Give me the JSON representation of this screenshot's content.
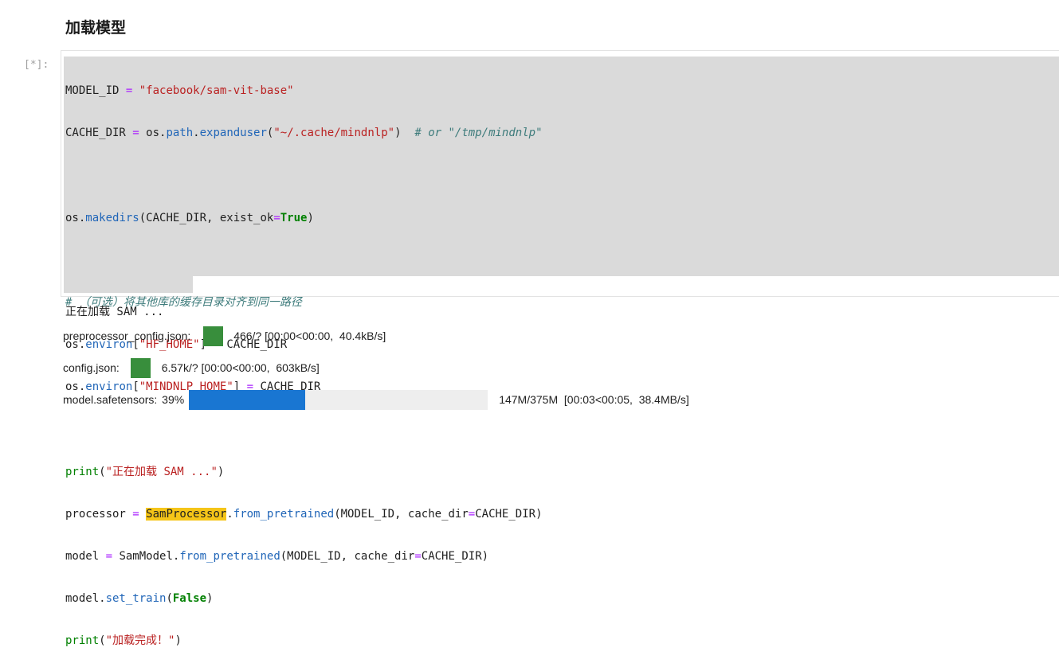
{
  "section_heading": "加载模型",
  "cell": {
    "prompt": "[*]:"
  },
  "code": {
    "l1_var": "MODEL_ID ",
    "l1_op": "=",
    "l1_str": "\"facebook/sam-vit-base\"",
    "l2_var": "CACHE_DIR ",
    "l2_op": "=",
    "l2_a": " os.",
    "l2_attr": "path",
    "l2_b": ".",
    "l2_attr2": "expanduser",
    "l2_c": "(",
    "l2_str": "\"~/.cache/mindnlp\"",
    "l2_d": ")  ",
    "l2_cm": "# or \"/tmp/mindnlp\"",
    "l4_a": "os.",
    "l4_attr": "makedirs",
    "l4_b": "(CACHE_DIR, exist_ok",
    "l4_op": "=",
    "l4_kw": "True",
    "l4_c": ")",
    "l6_cm": "# （可选）将其他库的缓存目录对齐到同一路径",
    "l7_a": "os.",
    "l7_attr": "environ",
    "l7_b": "[",
    "l7_str": "\"HF_HOME\"",
    "l7_c": "] ",
    "l7_op": "=",
    "l7_d": " CACHE_DIR",
    "l8_a": "os.",
    "l8_attr": "environ",
    "l8_b": "[",
    "l8_str": "\"MINDNLP_HOME\"",
    "l8_c": "] ",
    "l8_op": "=",
    "l8_d": " CACHE_DIR",
    "l10_bi": "print",
    "l10_a": "(",
    "l10_str": "\"正在加载 SAM ...\"",
    "l10_b": ")",
    "l11_a": "processor ",
    "l11_op": "=",
    "l11_sp": " ",
    "l11_hl": "SamProcessor",
    "l11_b": ".",
    "l11_attr": "from_pretrained",
    "l11_c": "(MODEL_ID, cache_dir",
    "l11_op2": "=",
    "l11_d": "CACHE_DIR)",
    "l12_a": "model ",
    "l12_op": "=",
    "l12_b": " SamModel.",
    "l12_attr": "from_pretrained",
    "l12_c": "(MODEL_ID, cache_dir",
    "l12_op2": "=",
    "l12_d": "CACHE_DIR)",
    "l13_a": "model.",
    "l13_attr": "set_train",
    "l13_b": "(",
    "l13_kw": "False",
    "l13_c": ")",
    "l14_bi": "print",
    "l14_a": "(",
    "l14_str": "\"加载完成！\"",
    "l14_b": ")"
  },
  "output": {
    "stdout": "正在加载 SAM ...",
    "progress": [
      {
        "label": "preprocessor_config.json: ",
        "percent": "",
        "progress_fraction": 1.0,
        "color": "#388e3c",
        "stats": "466/? [00:00<00:00,  40.4kB/s]"
      },
      {
        "label": "config.json: ",
        "percent": "",
        "progress_fraction": 1.0,
        "color": "#388e3c",
        "stats": "6.57k/? [00:00<00:00,  603kB/s]"
      },
      {
        "label": "model.safetensors: ",
        "percent": "39%",
        "progress_fraction": 0.39,
        "color": "#1976d2",
        "stats": "147M/375M  [00:03<00:05,  38.4MB/s]"
      }
    ]
  }
}
